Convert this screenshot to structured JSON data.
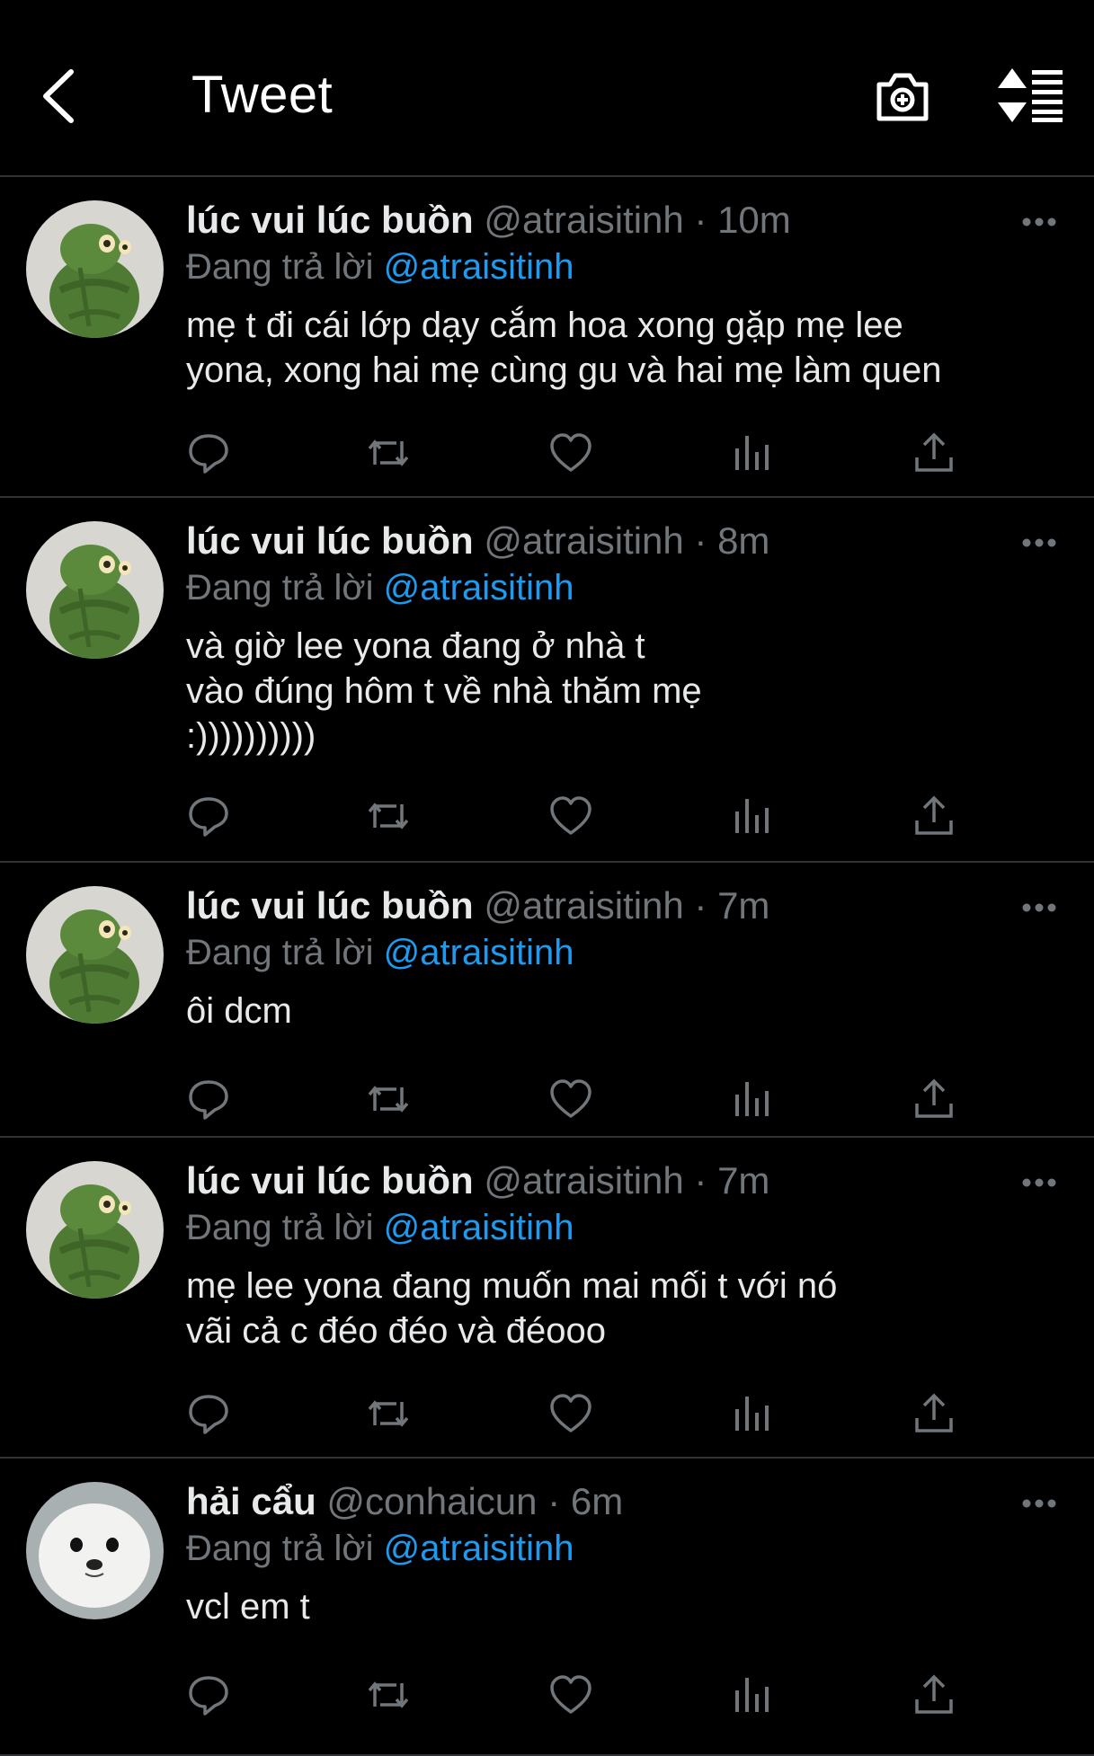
{
  "header": {
    "title": "Tweet"
  },
  "colors": {
    "background": "#000000",
    "accent": "#1d9bf0",
    "muted": "#71767b",
    "divider": "#2f3336"
  },
  "tweets": [
    {
      "name": "lúc vui lúc buồn",
      "handle": "@atraisitinh",
      "time": "· 10m",
      "reply_prefix": "Đang trả lời",
      "reply_to": "@atraisitinh",
      "text": "mẹ t đi cái lớp dạy cắm hoa xong gặp mẹ lee\nyona, xong hai mẹ cùng gu và hai mẹ làm quen",
      "avatar": "green-frog-plush"
    },
    {
      "name": "lúc vui lúc buồn",
      "handle": "@atraisitinh",
      "time": "· 8m",
      "reply_prefix": "Đang trả lời",
      "reply_to": "@atraisitinh",
      "text": "và giờ lee yona đang ở nhà t\nvào đúng hôm t về nhà thăm mẹ\n:))))))))))",
      "avatar": "green-frog-plush"
    },
    {
      "name": "lúc vui lúc buồn",
      "handle": "@atraisitinh",
      "time": "· 7m",
      "reply_prefix": "Đang trả lời",
      "reply_to": "@atraisitinh",
      "text": "ôi dcm",
      "avatar": "green-frog-plush"
    },
    {
      "name": "lúc vui lúc buồn",
      "handle": "@atraisitinh",
      "time": "· 7m",
      "reply_prefix": "Đang trả lời",
      "reply_to": "@atraisitinh",
      "text": "mẹ lee yona đang muốn mai mối t với nó\nvãi cả c đéo đéo và đéooo",
      "avatar": "green-frog-plush"
    },
    {
      "name": "hải cẩu",
      "handle": "@conhaicun",
      "time": "· 6m",
      "reply_prefix": "Đang trả lời",
      "reply_to": "@atraisitinh",
      "text": "vcl em t",
      "avatar": "white-seal"
    }
  ]
}
